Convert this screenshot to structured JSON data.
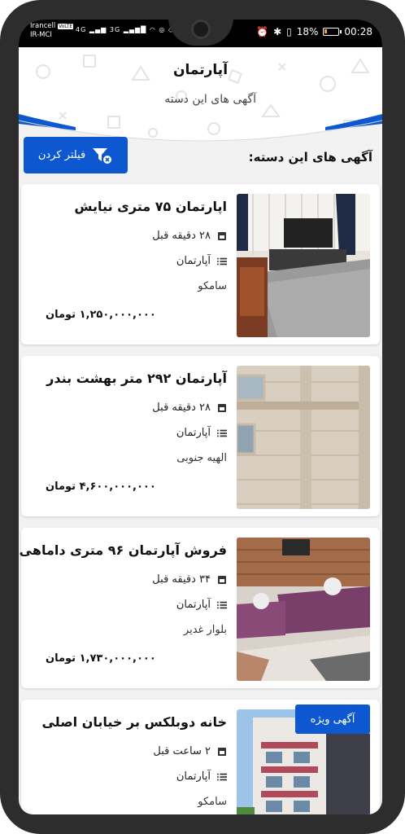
{
  "status_bar": {
    "operator_1": "Irancell",
    "operator_1_badge": "VoLTE",
    "operator_2": "IR-MCI",
    "network_1": "4G",
    "network_2": "3G",
    "battery_percent": "18%",
    "battery_level": 0.18,
    "time": "00:28"
  },
  "header": {
    "title": "آپارتمان",
    "subtitle": "آگهی های این دسته"
  },
  "section": {
    "title": "آگهی های این دسته:",
    "filter_label": "فیلتر کردن"
  },
  "colors": {
    "accent": "#0d58d1",
    "background": "#f2f2f2"
  },
  "listings": [
    {
      "title": "اپارتمان ۷۵ متری نیایش",
      "time": "۲۸ دقیقه قبل",
      "category": "آپارتمان",
      "location": "سامکو",
      "price": "۱,۲۵۰,۰۰۰,۰۰۰ تومان",
      "image": "living-room-photo"
    },
    {
      "title": "آپارتمان ۲۹۲ متر بهشت بندر",
      "time": "۲۸ دقیقه قبل",
      "category": "آپارتمان",
      "location": "الهیه جنوبی",
      "price": "۴,۶۰۰,۰۰۰,۰۰۰ تومان",
      "image": "stone-facade-photo"
    },
    {
      "title": "فروش آپارتمان ۹۶ متری داماهی",
      "time": "۳۴ دقیقه قبل",
      "category": "آپارتمان",
      "location": "بلوار غدیر",
      "price": "۱,۷۳۰,۰۰۰,۰۰۰ تومان",
      "image": "sofa-room-photo"
    },
    {
      "title": "خانه دوبلکس بر خیابان اصلی",
      "time": "۲ ساعت قبل",
      "category": "آپارتمان",
      "location": "سامکو",
      "badge": "آگهی ویژه",
      "image": "building-photo"
    }
  ]
}
